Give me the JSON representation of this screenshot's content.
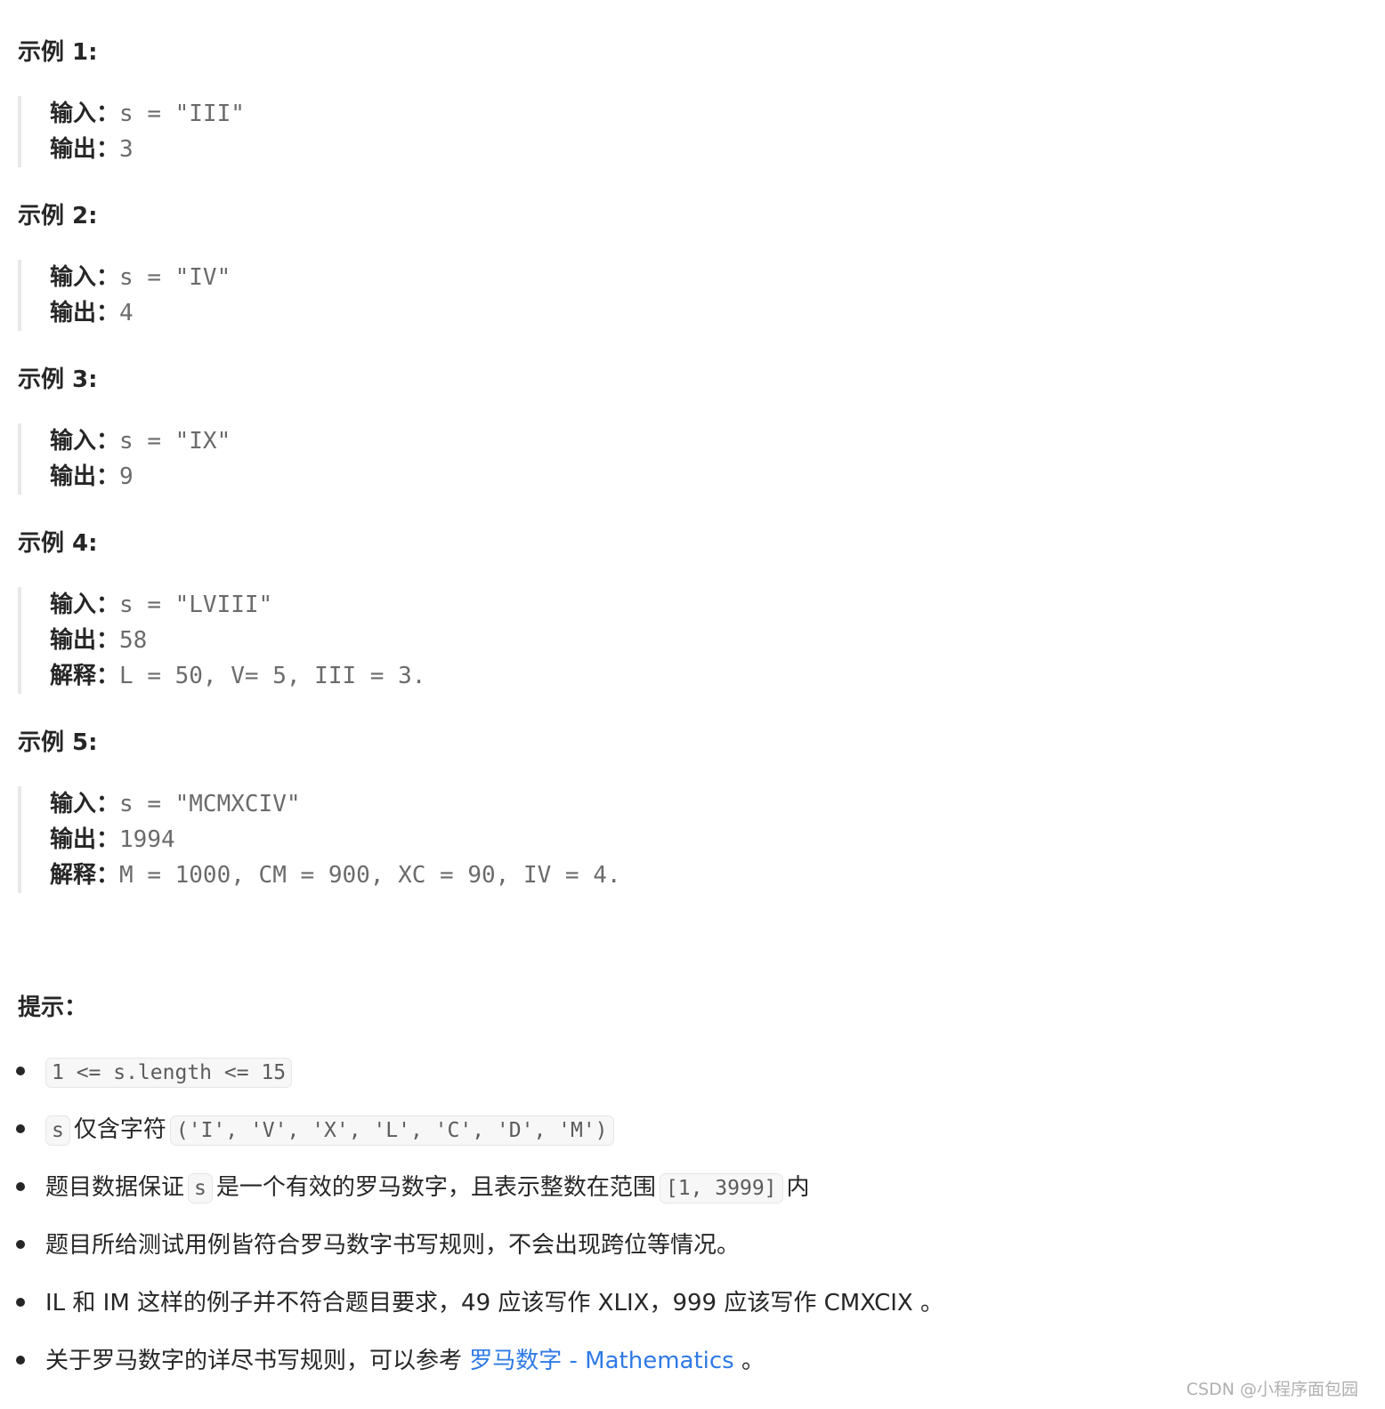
{
  "examples": [
    {
      "title": "示例 1:",
      "lines": [
        {
          "label": "输入：",
          "value": "s = \"III\""
        },
        {
          "label": "输出：",
          "value": "3"
        }
      ]
    },
    {
      "title": "示例 2:",
      "lines": [
        {
          "label": "输入：",
          "value": "s = \"IV\""
        },
        {
          "label": "输出：",
          "value": "4"
        }
      ]
    },
    {
      "title": "示例 3:",
      "lines": [
        {
          "label": "输入：",
          "value": "s = \"IX\""
        },
        {
          "label": "输出：",
          "value": "9"
        }
      ]
    },
    {
      "title": "示例 4:",
      "lines": [
        {
          "label": "输入：",
          "value": "s = \"LVIII\""
        },
        {
          "label": "输出：",
          "value": "58"
        },
        {
          "label": "解释：",
          "value": "L = 50, V= 5, III = 3."
        }
      ]
    },
    {
      "title": "示例 5:",
      "lines": [
        {
          "label": "输入：",
          "value": "s = \"MCMXCIV\""
        },
        {
          "label": "输出：",
          "value": "1994"
        },
        {
          "label": "解释：",
          "value": "M = 1000, CM = 900, XC = 90, IV = 4."
        }
      ]
    }
  ],
  "hints": {
    "title": "提示：",
    "items": [
      {
        "code1": "1 <= s.length <= 15"
      },
      {
        "code1": "s",
        "text1": "仅含字符",
        "code2": "('I', 'V', 'X', 'L', 'C', 'D', 'M')"
      },
      {
        "text1": "题目数据保证",
        "code1": "s",
        "text2": "是一个有效的罗马数字，且表示整数在范围",
        "code2": "[1, 3999]",
        "text3": "内"
      },
      {
        "text1": "题目所给测试用例皆符合罗马数字书写规则，不会出现跨位等情况。"
      },
      {
        "text1": "IL 和 IM 这样的例子并不符合题目要求，49 应该写作 XLIX，999 应该写作 CMXCIX 。"
      },
      {
        "text1": "关于罗马数字的详尽书写规则，可以参考 ",
        "link": "罗马数字 - Mathematics",
        "text2": " 。"
      }
    ]
  },
  "watermark": "CSDN @小程序面包园",
  "colors": {
    "link": "#2f7ae5",
    "code_bg": "#f7f7f7",
    "quote_border": "#e8e8e8"
  }
}
